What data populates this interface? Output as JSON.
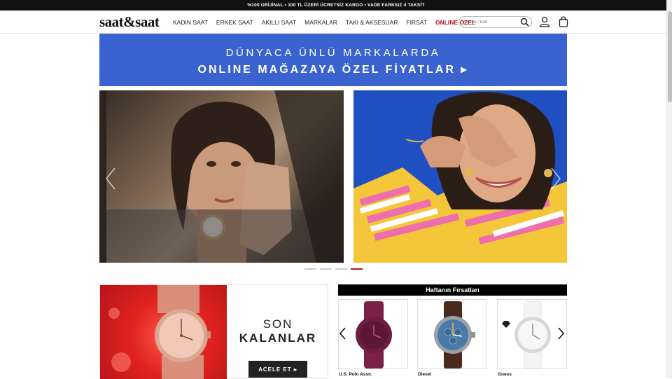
{
  "topbar": {
    "text": "%100 ORİJİNAL • 100 TL ÜZERİ ÜCRETSİZ KARGO • VADE FARKSIZ 4 TAKSİT"
  },
  "header": {
    "logo": "saat&saat",
    "nav": [
      "KADIN SAAT",
      "ERKEK SAAT",
      "AKILLI SAAT",
      "MARKALAR",
      "TAKI & AKSESUAR",
      "FIRSAT",
      "ONLINE ÖZEL"
    ],
    "search_placeholder": "Kelime / Kod",
    "accent_color": "#c0101a"
  },
  "banner": {
    "line1": "DÜNYACA ÜNLÜ MARKALARDA",
    "line2": "ONLINE MAĞAZAYA ÖZEL FİYATLAR ▸",
    "color": "#3a63d0"
  },
  "carousel": {
    "slide_count": 4,
    "active_index": 3
  },
  "promo": {
    "line1": "SON",
    "line2": "KALANLAR",
    "button": "ACELE ET ▸"
  },
  "deals": {
    "title": "Haftanın Fırsatları",
    "products": [
      {
        "brand": "U.S. Polo Assn."
      },
      {
        "brand": "Diesel"
      },
      {
        "brand": "Guess"
      }
    ]
  }
}
